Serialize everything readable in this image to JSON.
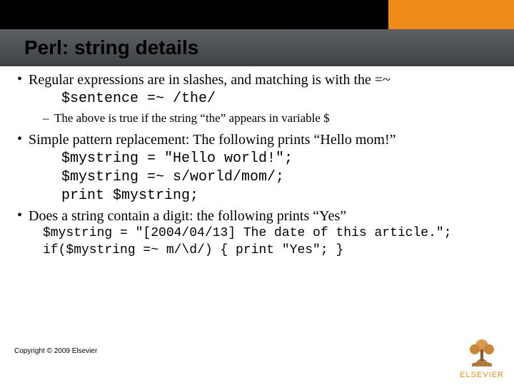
{
  "title": "Perl: string details",
  "bullets": {
    "b1": "Regular expressions are in slashes, and matching is with the =~",
    "b1_code": "$sentence =~ /the/",
    "b1_sub": "The above is true if the string “the” appears in variable $",
    "b2": "Simple pattern replacement: The following prints “Hello mom!”",
    "b2_code1": "$mystring = \"Hello world!\";",
    "b2_code2": "$mystring =~ s/world/mom/;",
    "b2_code3": "print $mystring;",
    "b3": "Does a string contain a digit: the following prints “Yes”",
    "b3_code1": "$mystring = \"[2004/04/13] The date of this article.\";",
    "b3_code2": "if($mystring =~ m/\\d/) { print \"Yes\"; }"
  },
  "copyright": "Copyright © 2009 Elsevier",
  "logo_label": "ELSEVIER"
}
